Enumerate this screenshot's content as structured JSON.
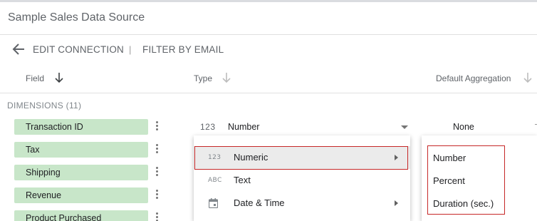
{
  "window": {
    "title": "Sample Sales Data Source"
  },
  "toolbar": {
    "edit_connection": "EDIT CONNECTION",
    "separator": "|",
    "filter_by_email": "FILTER BY EMAIL"
  },
  "columns": {
    "field": "Field",
    "type": "Type",
    "default_aggregation": "Default Aggregation"
  },
  "section": {
    "dimensions": "DIMENSIONS (11)"
  },
  "fields": [
    {
      "name": "Transaction ID"
    },
    {
      "name": "Tax"
    },
    {
      "name": "Shipping"
    },
    {
      "name": "Revenue"
    },
    {
      "name": "Product Purchased"
    }
  ],
  "first_row": {
    "type_glyph": "123",
    "type": "Number",
    "aggregation": "None"
  },
  "type_menu": {
    "items": [
      {
        "glyph": "123",
        "label": "Numeric",
        "has_submenu": true,
        "active": true
      },
      {
        "glyph": "ABC",
        "label": "Text",
        "has_submenu": false,
        "active": false
      },
      {
        "glyph": "calendar-icon",
        "label": "Date & Time",
        "has_submenu": true,
        "active": false
      }
    ]
  },
  "numeric_submenu": {
    "items": [
      "Number",
      "Percent",
      "Duration (sec.)"
    ]
  },
  "colors": {
    "chip_green": "#c8e6c9",
    "highlight_red": "#c62828",
    "active_item_bg": "#ebebeb"
  }
}
